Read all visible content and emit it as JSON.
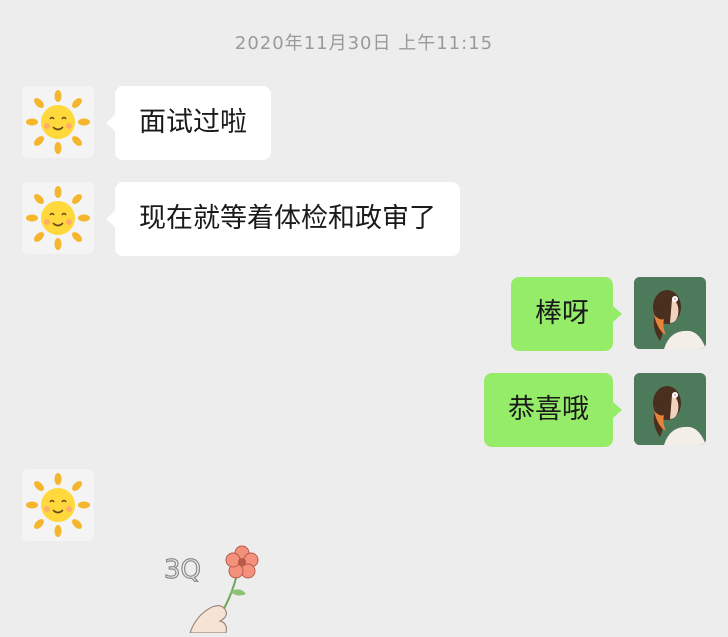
{
  "chat": {
    "timestamp": "2020年11月30日  上午11:15",
    "messages": [
      {
        "sender": "other",
        "text": "面试过啦"
      },
      {
        "sender": "other",
        "text": "现在就等着体检和政审了"
      },
      {
        "sender": "me",
        "text": "棒呀"
      },
      {
        "sender": "me",
        "text": "恭喜哦"
      },
      {
        "sender": "other",
        "sticker_text": "3Q"
      }
    ]
  },
  "colors": {
    "background": "#ededed",
    "incoming_bubble": "#ffffff",
    "outgoing_bubble": "#95ec69",
    "timestamp": "#9a9a9a"
  },
  "icons": {
    "other_avatar": "sun-avatar-icon",
    "my_avatar": "girl-avatar-icon",
    "sticker": "thank-you-flower-sticker"
  }
}
